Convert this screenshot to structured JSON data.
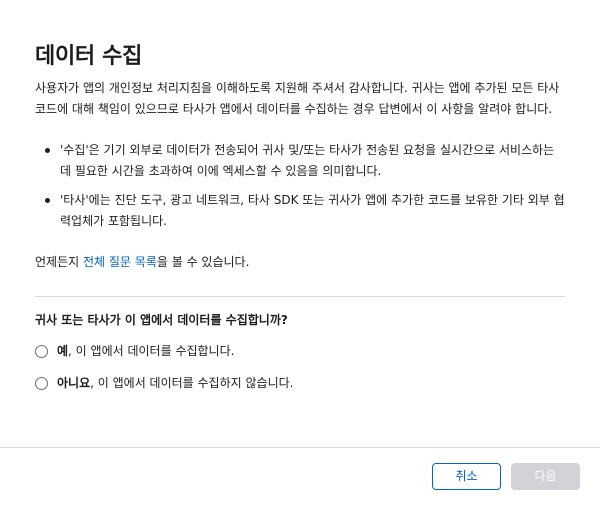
{
  "dialog": {
    "title": "데이터 수집",
    "intro": "사용자가 앱의 개인정보 처리지침을 이해하도록 지원해 주셔서 감사합니다. 귀사는 앱에 추가된 모든 타사 코드에 대해 책임이 있으므로 타사가 앱에서 데이터를 수집하는 경우 답변에서 이 사항을 알려야 합니다.",
    "bullets": [
      "'수집'은 기기 외부로 데이터가 전송되어 귀사 및/또는 타사가 전송된 요청을 실시간으로 서비스하는 데 필요한 시간을 초과하여 이에 엑세스할 수 있음을 의미합니다.",
      "'타사'에는 진단 도구, 광고 네트워크, 타사 SDK 또는 귀사가 앱에 추가한 코드를 보유한 기타 외부 협력업체가 포함됩니다."
    ],
    "faq": {
      "prefix": "언제든지 ",
      "link": "전체 질문 목록",
      "suffix": "을 볼 수 있습니다."
    },
    "question": "귀사 또는 타사가 이 앱에서 데이터를 수집합니까?",
    "options": {
      "yes": {
        "strong": "예",
        "rest": ", 이 앱에서 데이터를 수집합니다."
      },
      "no": {
        "strong": "아니요",
        "rest": ", 이 앱에서 데이터를 수집하지 않습니다."
      }
    }
  },
  "footer": {
    "cancel_label": "취소",
    "next_label": "다음"
  },
  "colors": {
    "link": "#0066cc",
    "disabled_button": "#d2d2d7",
    "divider": "#d9d9d9"
  }
}
